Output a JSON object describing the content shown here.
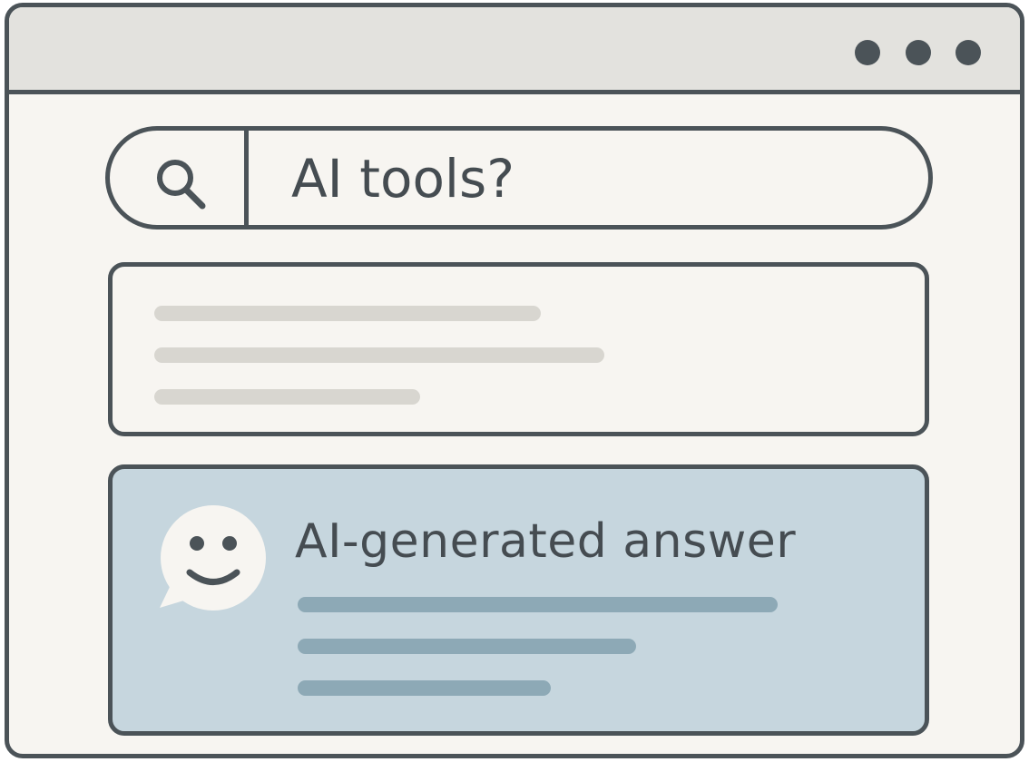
{
  "window": {
    "controls": [
      "dot",
      "dot",
      "dot"
    ]
  },
  "search": {
    "icon": "search-icon",
    "query": "AI tools?"
  },
  "result_card": {
    "placeholder_lines": 3
  },
  "ai_card": {
    "icon": "smiley-chat-bubble-icon",
    "title": "AI-generated answer",
    "placeholder_lines": 3
  },
  "colors": {
    "outline": "#4b5358",
    "page_background": "#f7f5f1",
    "titlebar": "#e3e2de",
    "ai_card_background": "#c6d6de",
    "ai_placeholder_lines": "#8da9b6",
    "result_placeholder_lines": "#d8d6d0"
  }
}
